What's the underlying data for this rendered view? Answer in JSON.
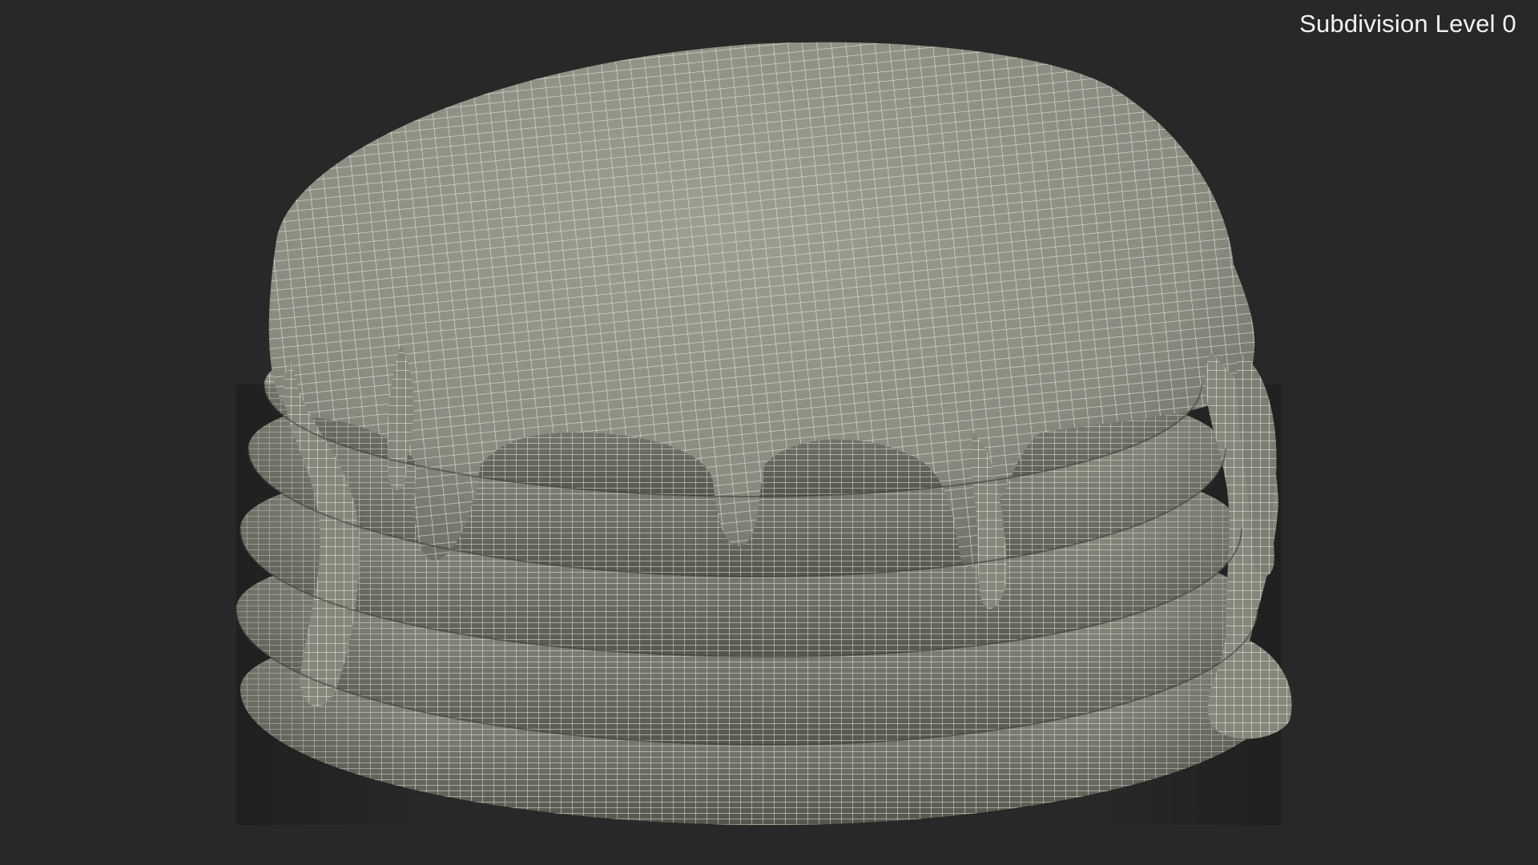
{
  "viewport": {
    "overlay_label": "Subdivision Level 0",
    "model": "pancake-stack-with-syrup",
    "render_mode": "wireframe-on-shaded",
    "colors": {
      "background": "#282828",
      "surface": "#8a8a7f",
      "surface_dark": "#5e5e55",
      "wire": "#e6e6dc",
      "label": "#f2f2f2"
    }
  }
}
